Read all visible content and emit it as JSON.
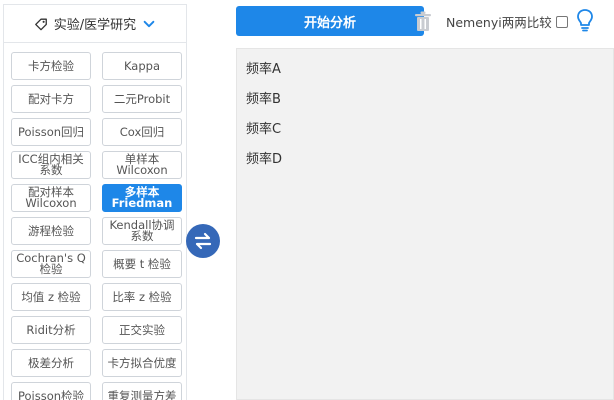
{
  "category": {
    "label": "实验/医学研究"
  },
  "methods": [
    {
      "label": "卡方检验",
      "active": false
    },
    {
      "label": "Kappa",
      "active": false
    },
    {
      "label": "配对卡方",
      "active": false
    },
    {
      "label": "二元Probit",
      "active": false
    },
    {
      "label": "Poisson回归",
      "active": false
    },
    {
      "label": "Cox回归",
      "active": false
    },
    {
      "label": "ICC组内相关系数",
      "active": false
    },
    {
      "label": "单样本Wilcoxon",
      "active": false
    },
    {
      "label": "配对样本Wilcoxon",
      "active": false
    },
    {
      "label": "多样本Friedman",
      "active": true
    },
    {
      "label": "游程检验",
      "active": false
    },
    {
      "label": "Kendall协调系数",
      "active": false
    },
    {
      "label": "Cochran's Q检验",
      "active": false
    },
    {
      "label": "概要 t 检验",
      "active": false
    },
    {
      "label": "均值 z 检验",
      "active": false
    },
    {
      "label": "比率 z 检验",
      "active": false
    },
    {
      "label": "Ridit分析",
      "active": false
    },
    {
      "label": "正交实验",
      "active": false
    },
    {
      "label": "极差分析",
      "active": false
    },
    {
      "label": "卡方拟合优度",
      "active": false
    },
    {
      "label": "Poisson检验",
      "active": false
    },
    {
      "label": "重复测量方差",
      "active": false
    }
  ],
  "toolbar": {
    "start_label": "开始分析",
    "nemenyi_label": "Nemenyi两两比较"
  },
  "variables": [
    {
      "label": "频率A"
    },
    {
      "label": "频率B"
    },
    {
      "label": "频率C"
    },
    {
      "label": "频率D"
    }
  ],
  "colors": {
    "primary": "#1e87e8",
    "swap": "#3568b8",
    "panel_bg": "#f2f2f2"
  }
}
